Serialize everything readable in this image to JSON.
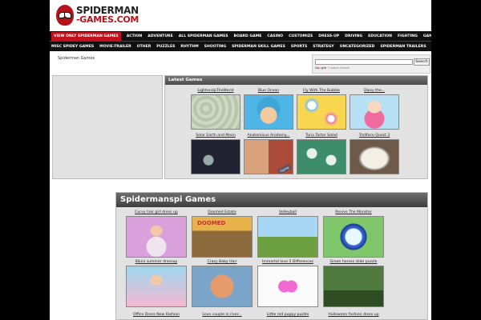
{
  "logo": {
    "line1": "SPIDERMAN",
    "line2": "-GAMES.COM"
  },
  "nav": {
    "row1": [
      "VIEW ONLY SPIDERMAN GAMES",
      "ACTION",
      "ADVENTURE",
      "ALL SPIDERMAN GAMES",
      "BOARD GAME",
      "CASINO",
      "CUSTOMIZE",
      "DRESS-UP",
      "DRIVING",
      "EDUCATION",
      "FIGHTING",
      "GAMES",
      "JIGSAW"
    ],
    "row2": [
      "MISC SPIDEY GAMES",
      "MOVIE-TRAILER",
      "OTHER",
      "PUZZLES",
      "RHYTHM",
      "SHOOTING",
      "SPIDERMAN SKILL GAMES",
      "SPORTS",
      "STRATEGY",
      "UNCATEGORIZED",
      "SPIDERMAN TRAILERS",
      "SUBMIT GAME"
    ],
    "active_index": 0,
    "active_color": "#c1121c"
  },
  "breadcrumb": "Spiderman Games",
  "search": {
    "button": "Search",
    "brand": "Google",
    "brand_suffix": "Custom Search",
    "value": ""
  },
  "latest": {
    "title": "Latest Games",
    "games": [
      "LightenUpTheWorld",
      "Blue Ocean",
      "Fly With The Bubble",
      "Daisy the...",
      "Solar Earth and Moon",
      "Anatomicus Anatomy...",
      "Tuna Tartar Salad",
      "Trollface Quest 3"
    ],
    "thumb_icons": [
      "light-art",
      "blue-ocean-art",
      "bubble-art",
      "daisy-art",
      "space-art",
      "anatomy-art",
      "tuna-art",
      "troll-art"
    ]
  },
  "spidermanspi": {
    "title": "Spidermanspi Games",
    "games": [
      "Curvy hair girl dress up",
      "Doomed Estate",
      "Volleyball",
      "Revive The Monster",
      "Bikini summer dressup",
      "Crazy Baby Hair",
      "Immortal love 5 Differences",
      "Green horses slide puzzle"
    ],
    "next_row": [
      "Office Dress New Fashion",
      "Love couple in river...",
      "Little red puppy puzzle",
      "Halloween fashion dress up"
    ]
  },
  "thumb_text": {
    "anatomy_badge": "Game",
    "doomed": "DOOMED"
  }
}
